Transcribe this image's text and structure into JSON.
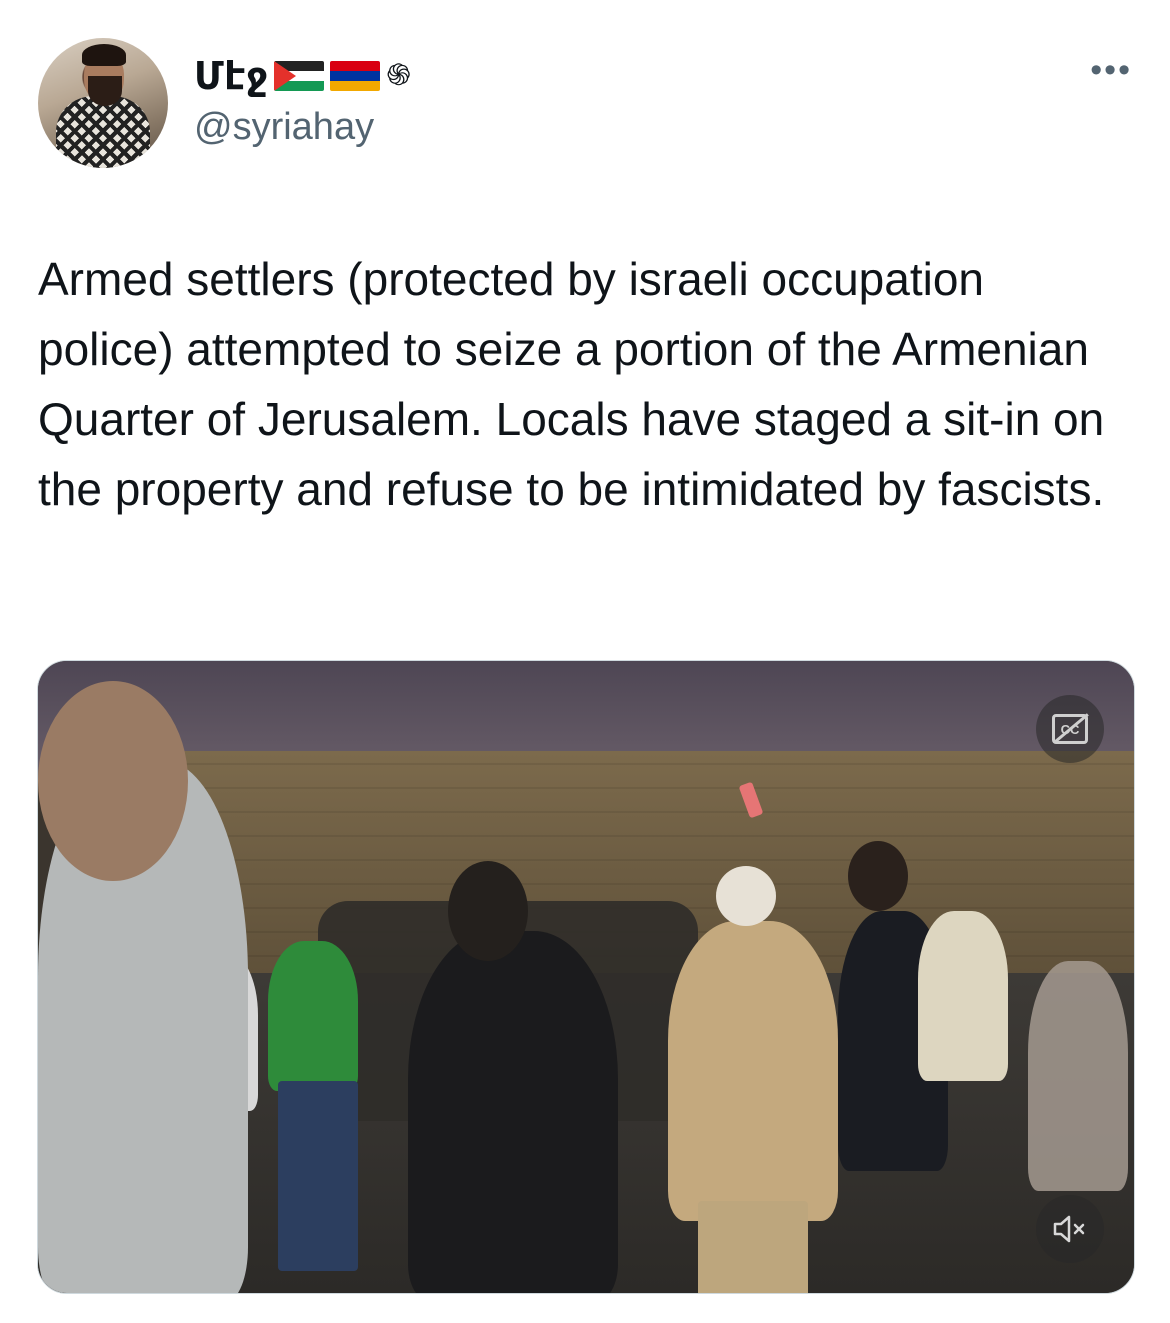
{
  "tweet": {
    "author": {
      "display_name": "Մէջ",
      "flags": [
        "palestine-flag-icon",
        "armenia-flag-icon",
        "eternity-sign-icon"
      ],
      "handle": "@syriahay"
    },
    "more_icon": "more-options-icon",
    "text": "Armed settlers (protected by israeli occupation police) attempted to seize a portion of the Armenian Quarter of Jerusalem. Locals have staged a sit-in on the property and refuse to be intimidated by fascists.",
    "media": {
      "type": "video",
      "captions_icon": "captions-off-icon",
      "mute_icon": "muted-speaker-icon"
    }
  },
  "colors": {
    "text_primary": "#0f1419",
    "text_secondary": "#536471",
    "media_border": "#cfd9de"
  }
}
